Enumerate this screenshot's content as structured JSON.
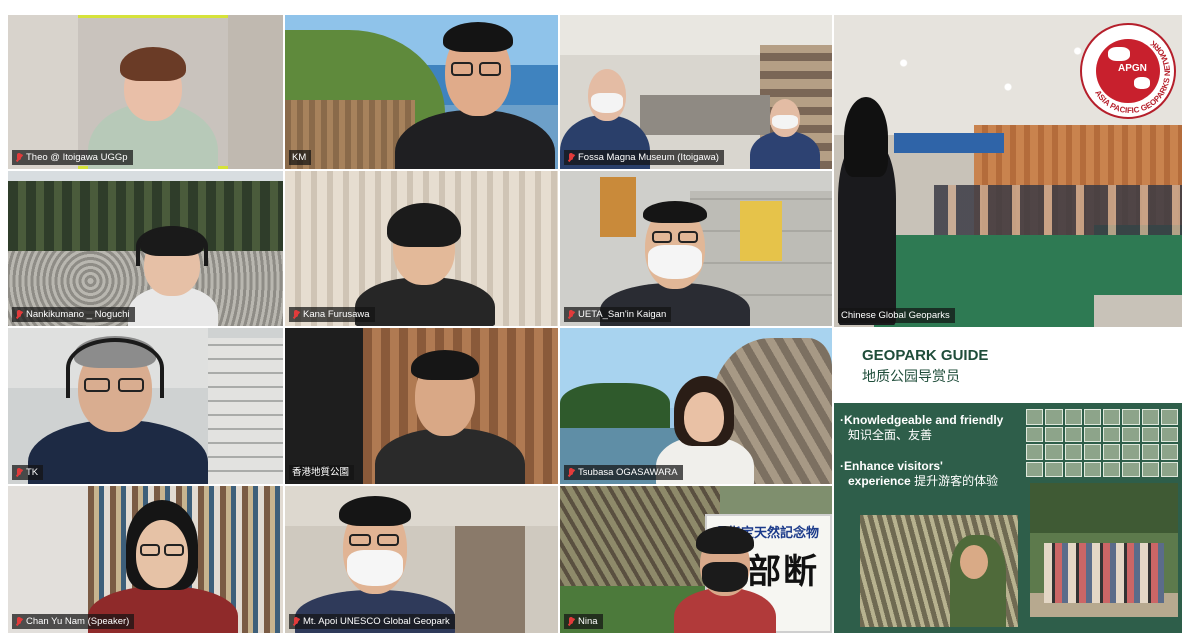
{
  "participants": [
    {
      "name": "Theo @ Itoigawa UGGp",
      "active": true
    },
    {
      "name": "KM"
    },
    {
      "name": "Fossa Magna Museum (Itoigawa)"
    },
    {
      "name": "Chinese Global Geoparks"
    },
    {
      "name": "Nankikumano _ Noguchi"
    },
    {
      "name": "Kana Furusawa"
    },
    {
      "name": "UETA_San'in Kaigan"
    },
    {
      "name": "TK"
    },
    {
      "name": "香港地質公園"
    },
    {
      "name": "Tsubasa OGASAWARA"
    },
    {
      "name": "Chan Yu Nam (Speaker)"
    },
    {
      "name": "Mt. Apoi UNESCO Global Geopark"
    },
    {
      "name": "Nina"
    }
  ],
  "logo": {
    "abbr": "APGN",
    "ring_text": "ASIA PACIFIC GEOPARKS NETWORK"
  },
  "slide": {
    "title": "GEOPARK GUIDE",
    "subtitle": "地质公园导赏员",
    "bullets": [
      {
        "en": "Knowledgeable and friendly",
        "cn": "知识全面、友善"
      },
      {
        "en": "Enhance visitors'",
        "en2": "experience",
        "cn": "提升游客的体验"
      }
    ]
  },
  "sign": {
    "line1": "県指定天然記念物",
    "line2": "丹部断層"
  },
  "colors": {
    "active_border": "#d6e23a",
    "slide_green": "#2e5e4a",
    "mic_muted": "#e23b3b",
    "logo_red": "#c8202d"
  }
}
